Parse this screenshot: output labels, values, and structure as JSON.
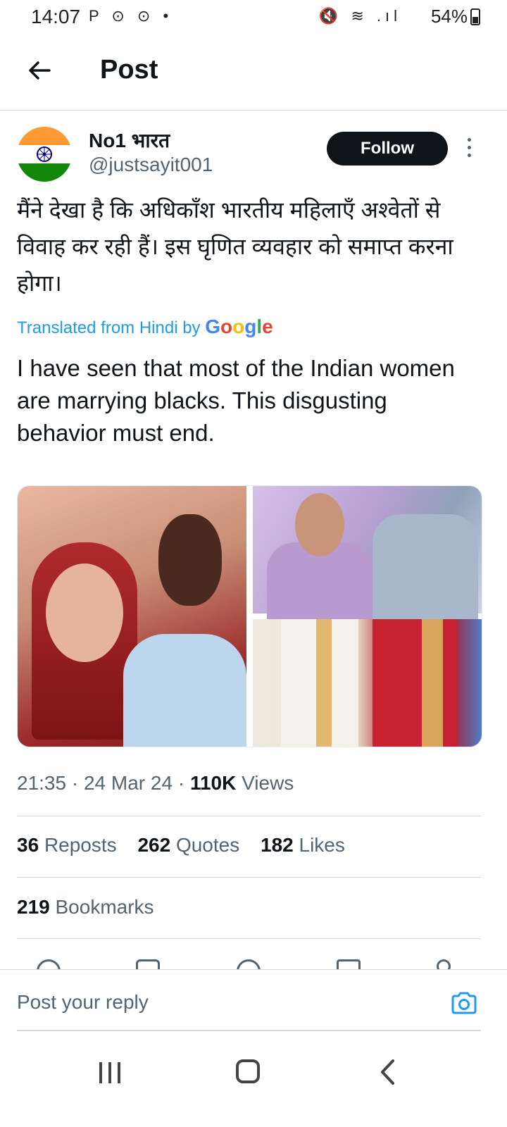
{
  "status_bar": {
    "time": "14:07",
    "left_icons": "P ⊙ ⊙ •",
    "right_icons": "🔇 ≋ .ıl",
    "battery": "54%"
  },
  "header": {
    "title": "Post",
    "back_icon": "arrow-left-icon"
  },
  "author": {
    "name": "No1 भारत",
    "handle": "@justsayit001",
    "follow_label": "Follow",
    "avatar": "india-flag-avatar"
  },
  "post": {
    "original_text": "मैंने देखा है कि अधिकाँश भारतीय महिलाएँ अश्वेतों से विवाह कर रही हैं।  इस घृणित व्यवहार को समाप्त करना होगा।",
    "translated_by": "Translated from Hindi by",
    "translator": "Google",
    "translation": "I have seen that most of the Indian women are marrying blacks. This disgusting behavior must end."
  },
  "meta": {
    "time": "21:35",
    "date": "24 Mar 24",
    "views_count": "110K",
    "views_label": "Views"
  },
  "stats": {
    "reposts_count": "36",
    "reposts_label": "Reposts",
    "quotes_count": "262",
    "quotes_label": "Quotes",
    "likes_count": "182",
    "likes_label": "Likes",
    "bookmarks_count": "219",
    "bookmarks_label": "Bookmarks"
  },
  "reply": {
    "placeholder": "Post your reply"
  },
  "google_colors": [
    "#4285F4",
    "#EA4335",
    "#FBBC05",
    "#4285F4",
    "#34A853",
    "#EA4335"
  ]
}
